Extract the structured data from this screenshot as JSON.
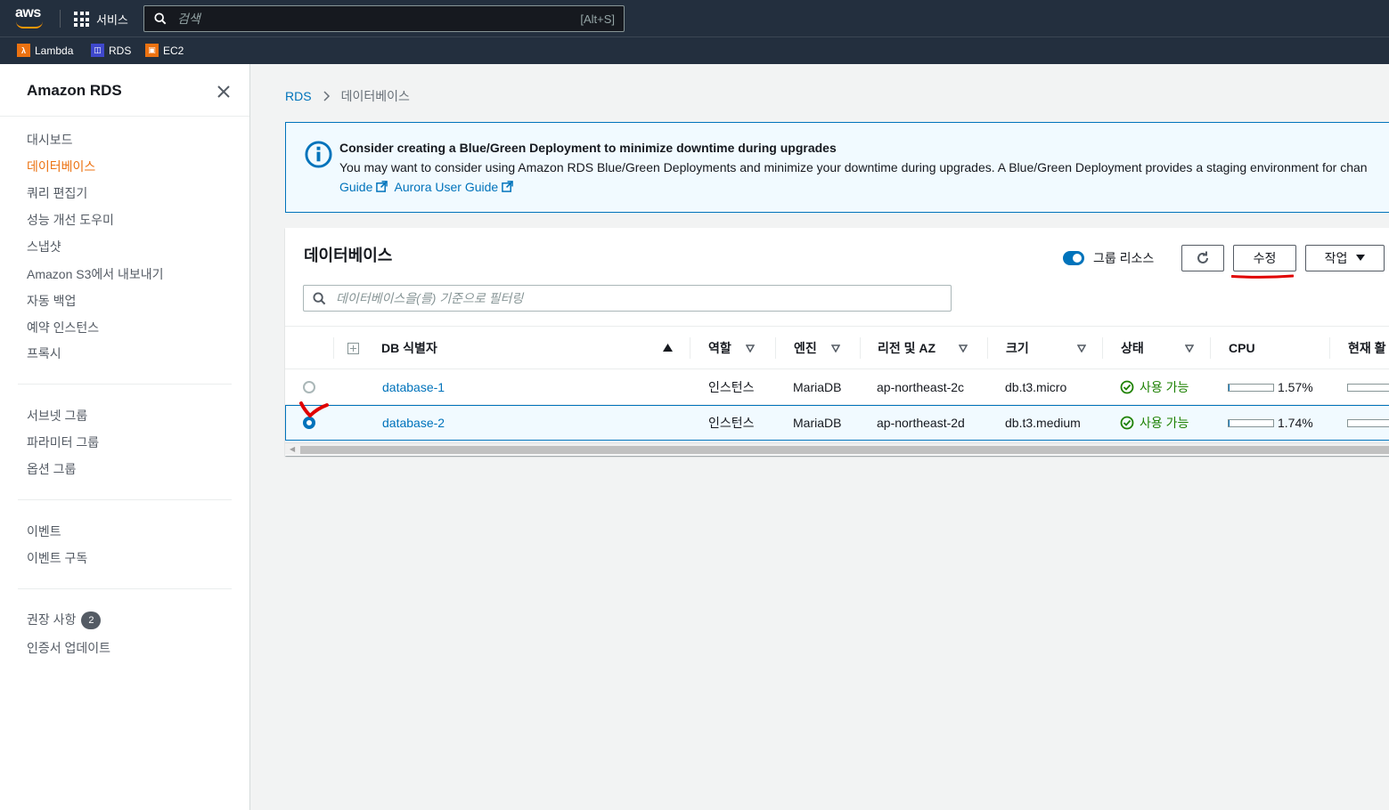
{
  "topbar": {
    "logo_text": "aws",
    "services_label": "서비스",
    "search_placeholder": "검색",
    "search_shortcut": "[Alt+S]"
  },
  "favorites": [
    {
      "label": "Lambda",
      "icon": "lambda-icon",
      "color": "#ec7211"
    },
    {
      "label": "RDS",
      "icon": "rds-icon",
      "color": "#3f48cc"
    },
    {
      "label": "EC2",
      "icon": "ec2-icon",
      "color": "#ec7211"
    }
  ],
  "sidebar": {
    "title": "Amazon RDS",
    "items": [
      {
        "label": "대시보드"
      },
      {
        "label": "데이터베이스",
        "active": true
      },
      {
        "label": "쿼리 편집기"
      },
      {
        "label": "성능 개선 도우미"
      },
      {
        "label": "스냅샷"
      },
      {
        "label": "Amazon S3에서 내보내기"
      },
      {
        "label": "자동 백업"
      },
      {
        "label": "예약 인스턴스"
      },
      {
        "label": "프록시"
      }
    ],
    "items2": [
      {
        "label": "서브넷 그룹"
      },
      {
        "label": "파라미터 그룹"
      },
      {
        "label": "옵션 그룹"
      }
    ],
    "items3": [
      {
        "label": "이벤트"
      },
      {
        "label": "이벤트 구독"
      }
    ],
    "items4": [
      {
        "label": "권장 사항",
        "badge": "2"
      },
      {
        "label": "인증서 업데이트"
      }
    ]
  },
  "breadcrumb": {
    "root": "RDS",
    "current": "데이터베이스"
  },
  "banner": {
    "title": "Consider creating a Blue/Green Deployment to minimize downtime during upgrades",
    "body": "You may want to consider using Amazon RDS Blue/Green Deployments and minimize your downtime during upgrades. A Blue/Green Deployment provides a staging environment for chan",
    "link1": "Guide",
    "link2": "Aurora User Guide"
  },
  "panel": {
    "title": "데이터베이스",
    "group_toggle_label": "그룹 리소스",
    "modify_button": "수정",
    "actions_button": "작업",
    "filter_placeholder": "데이터베이스을(를) 기준으로 필터링"
  },
  "table": {
    "columns": [
      "DB 식별자",
      "역할",
      "엔진",
      "리전 및 AZ",
      "크기",
      "상태",
      "CPU",
      "현재 활"
    ],
    "rows": [
      {
        "id": "database-1",
        "role": "인스턴스",
        "engine": "MariaDB",
        "region": "ap-northeast-2c",
        "size": "db.t3.micro",
        "status": "사용 가능",
        "cpu": "1.57%",
        "cpu_value": 1.57,
        "selected": false
      },
      {
        "id": "database-2",
        "role": "인스턴스",
        "engine": "MariaDB",
        "region": "ap-northeast-2d",
        "size": "db.t3.medium",
        "status": "사용 가능",
        "cpu": "1.74%",
        "cpu_value": 1.74,
        "selected": true
      }
    ]
  },
  "colors": {
    "accent": "#0073bb",
    "active_nav": "#ec7211",
    "status_ok": "#1d8102",
    "annotation_red": "#e00000"
  }
}
